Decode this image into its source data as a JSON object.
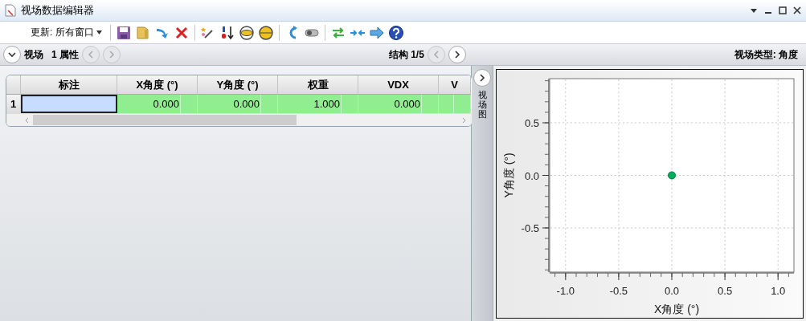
{
  "window": {
    "title": "视场数据编辑器"
  },
  "toolbar": {
    "update_menu": "更新: 所有窗口"
  },
  "header": {
    "section": "视场",
    "count": "1 属性",
    "structure": "结构 1/5",
    "field_type": "视场类型: 角度",
    "expanded": true
  },
  "table": {
    "columns": [
      "标注",
      "X角度 (°)",
      "Y角度 (°)",
      "权重",
      "VDX",
      "V"
    ],
    "rows": [
      {
        "number": "1",
        "cells": [
          {
            "selected": true
          },
          {
            "value": "0.000",
            "selected": false
          },
          {
            "value": "0.000",
            "selected": false
          },
          {
            "value": "1.000",
            "selected": false
          },
          {
            "value": "0.000",
            "selected": false
          },
          {
            "selected": false
          }
        ]
      }
    ]
  },
  "side_tab": {
    "label": "视场图"
  },
  "plot": {
    "chart_data": {
      "type": "scatter",
      "xlabel": "X角度 (°)",
      "ylabel": "Y角度 (°)",
      "xlim": [
        -1.15,
        1.15
      ],
      "ylim": [
        -0.92,
        0.92
      ],
      "xticks": [
        {
          "value": -1,
          "label": "-1.0"
        },
        {
          "value": -0.5,
          "label": "-0.5"
        },
        {
          "value": 0,
          "label": "0.0"
        },
        {
          "value": 0.5,
          "label": "0.5"
        },
        {
          "value": 1,
          "label": "1.0"
        }
      ],
      "yticks": [
        {
          "value": -0.5,
          "label": "-0.5"
        },
        {
          "value": 0,
          "label": "0.0"
        },
        {
          "value": 0.5,
          "label": "0.5"
        }
      ],
      "grid": true,
      "series": [
        {
          "color": "#00b060",
          "x": [
            0
          ],
          "values": [
            0
          ]
        }
      ]
    }
  }
}
